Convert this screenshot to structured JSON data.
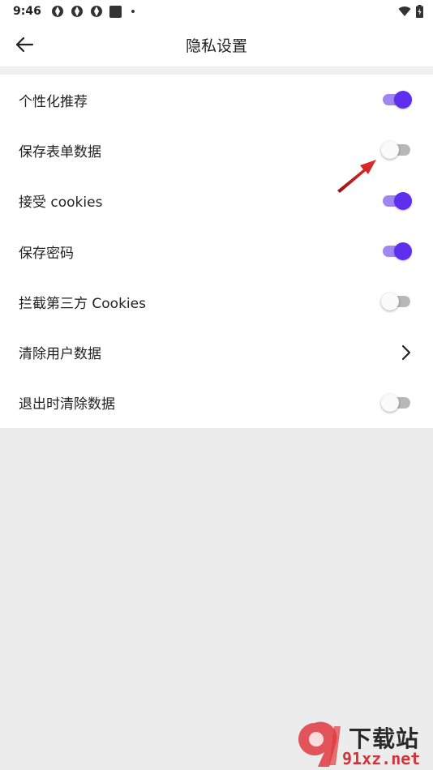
{
  "status_bar": {
    "time": "9:46",
    "icons": [
      "app-notification-icon",
      "app-notification-icon",
      "app-notification-icon",
      "square-notification-icon",
      "dot-icon",
      "wifi-icon",
      "battery-charging-icon"
    ]
  },
  "app_bar": {
    "title": "隐私设置",
    "back_icon": "arrow-left-icon"
  },
  "settings": [
    {
      "label": "个性化推荐",
      "control": "toggle",
      "on": true
    },
    {
      "label": "保存表单数据",
      "control": "toggle",
      "on": false
    },
    {
      "label": "接受 cookies",
      "control": "toggle",
      "on": true
    },
    {
      "label": "保存密码",
      "control": "toggle",
      "on": true
    },
    {
      "label": "拦截第三方 Cookies",
      "control": "toggle",
      "on": false
    },
    {
      "label": "清除用户数据",
      "control": "chevron"
    },
    {
      "label": "退出时清除数据",
      "control": "toggle",
      "on": false
    }
  ],
  "annotation": {
    "icon": "red-arrow-icon",
    "color": "#d32020"
  },
  "colors": {
    "toggle_on_thumb": "#5f2ff0",
    "toggle_on_track": "#9f86f2",
    "toggle_off_track": "#b8b8b8",
    "page_background": "#ececec"
  },
  "watermark": {
    "text_top": "下载站",
    "text_bottom": "91xz.net"
  }
}
